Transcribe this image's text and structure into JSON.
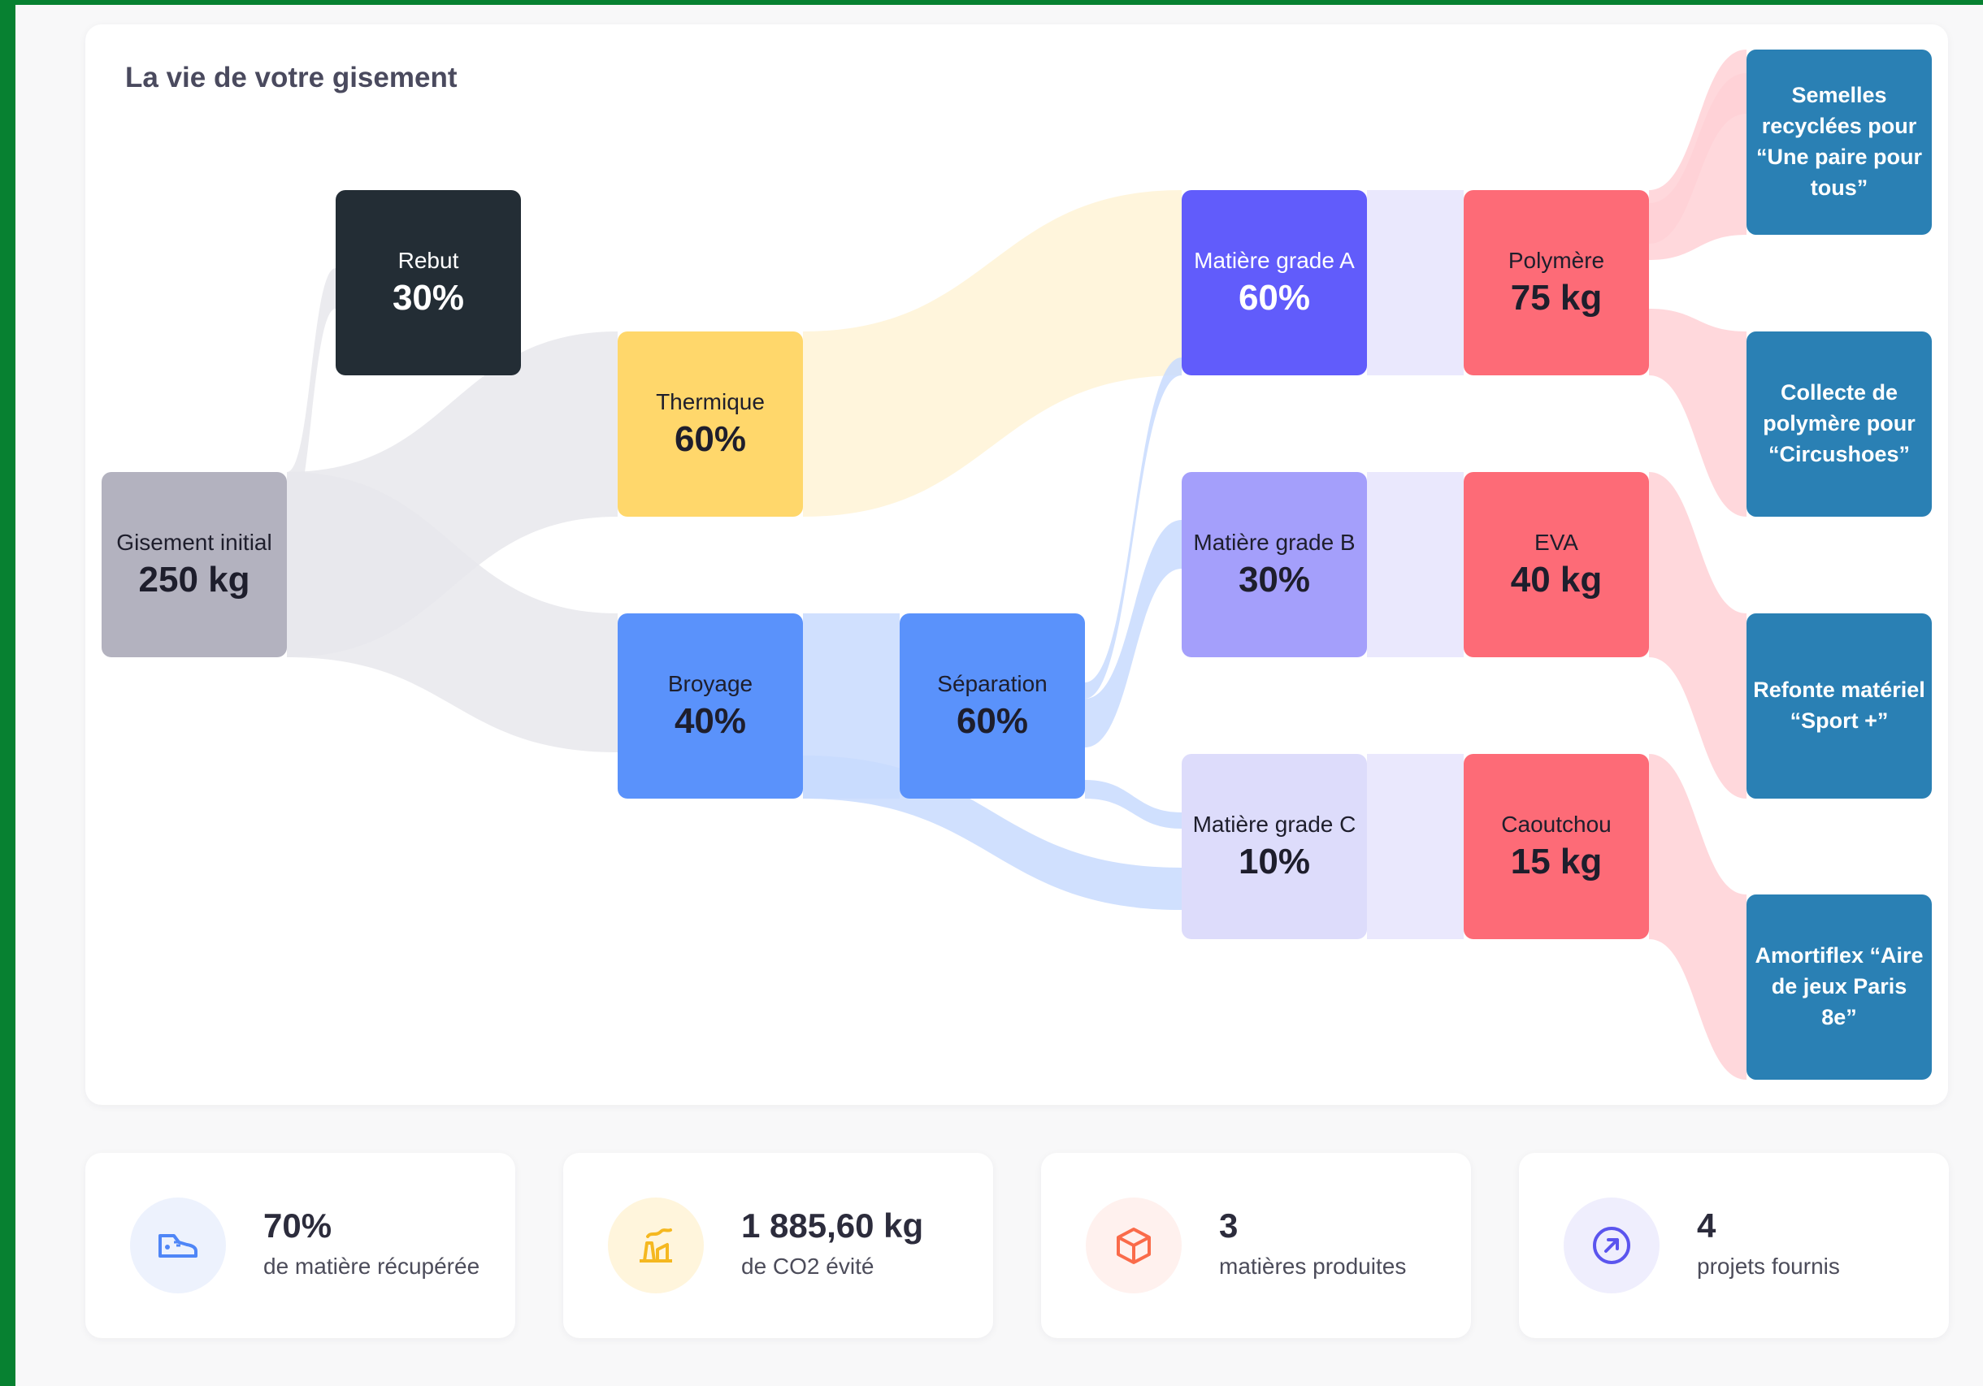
{
  "card_title": "La vie de votre gisement",
  "colors": {
    "frame": "#078131",
    "gisement": "#b3b2bf",
    "rebut": "#232d35",
    "thermique": "#ffd76b",
    "broyage": "#5a92fb",
    "grade_a": "#615cfb",
    "grade_b": "#a49ffb",
    "grade_c": "#dddcfb",
    "material": "#fd6b77",
    "project": "#2a80b4",
    "flow_grey": "#e8e8ec",
    "flow_yellow": "#fff3d6",
    "flow_blue": "#c8dafe",
    "flow_purple": "#e6e4fd",
    "flow_pink": "#ffd1d6"
  },
  "nodes": {
    "gisement": {
      "label": "Gisement initial",
      "value": "250 kg"
    },
    "rebut": {
      "label": "Rebut",
      "value": "30%"
    },
    "thermique": {
      "label": "Thermique",
      "value": "60%"
    },
    "broyage": {
      "label": "Broyage",
      "value": "40%"
    },
    "separation": {
      "label": "Séparation",
      "value": "60%"
    },
    "grade_a": {
      "label": "Matière grade A",
      "value": "60%"
    },
    "grade_b": {
      "label": "Matière grade B",
      "value": "30%"
    },
    "grade_c": {
      "label": "Matière grade C",
      "value": "10%"
    },
    "polymere": {
      "label": "Polymère",
      "value": "75 kg"
    },
    "eva": {
      "label": "EVA",
      "value": "40 kg"
    },
    "caoutchou": {
      "label": "Caoutchou",
      "value": "15 kg"
    }
  },
  "projects": [
    {
      "label": "Semelles recyclées pour “Une paire pour tous”"
    },
    {
      "label": "Collecte de polymère pour “Circushoes”"
    },
    {
      "label": "Refonte matériel “Sport +”"
    },
    {
      "label": "Amortiflex “Aire de jeux Paris 8e”"
    }
  ],
  "stats": [
    {
      "value": "70%",
      "label": "de matière récupérée",
      "icon": "shoe-icon"
    },
    {
      "value": "1 885,60 kg",
      "label": "de CO2 évité",
      "icon": "factory-icon"
    },
    {
      "value": "3",
      "label": "matières produites",
      "icon": "box-icon"
    },
    {
      "value": "4",
      "label": "projets fournis",
      "icon": "arrow-circle-icon"
    }
  ]
}
